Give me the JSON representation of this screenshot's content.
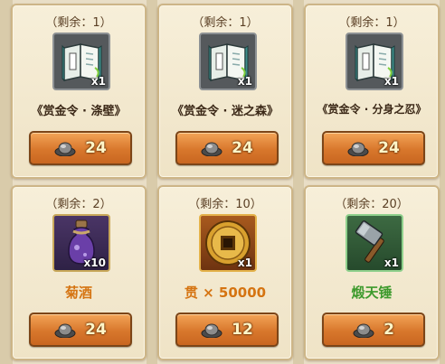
{
  "items": [
    {
      "remaining": "（剩余：1）",
      "quantity": "x1",
      "name": "《赏金令 · 涤壁》",
      "price": "24",
      "icon": "scroll-icon",
      "slot_color": "gray",
      "name_color": "dark"
    },
    {
      "remaining": "（剩余：1）",
      "quantity": "x1",
      "name": "《赏金令 · 迷之森》",
      "price": "24",
      "icon": "scroll-icon",
      "slot_color": "gray",
      "name_color": "dark"
    },
    {
      "remaining": "（剩余：1）",
      "quantity": "x1",
      "name": "《赏金令 · 分身之忍》",
      "price": "24",
      "icon": "scroll-icon",
      "slot_color": "gray",
      "name_color": "dark"
    },
    {
      "remaining": "（剩余：2）",
      "quantity": "x10",
      "name": "菊酒",
      "price": "24",
      "icon": "wine-bottle-icon",
      "slot_color": "purple",
      "name_color": "orange"
    },
    {
      "remaining": "（剩余：10）",
      "quantity": "x1",
      "name": "贯 × 50000",
      "price": "12",
      "icon": "coin-icon",
      "slot_color": "orange",
      "name_color": "orange"
    },
    {
      "remaining": "（剩余：20）",
      "quantity": "x1",
      "name": "煅天锤",
      "price": "2",
      "icon": "hammer-icon",
      "slot_color": "green",
      "name_color": "green"
    }
  ],
  "currency_icon": "ingot-icon",
  "colors": {
    "button": "#d8772c",
    "price_text": "#fff6c8",
    "orange_name": "#d57412",
    "green_name": "#3c9a2c"
  }
}
